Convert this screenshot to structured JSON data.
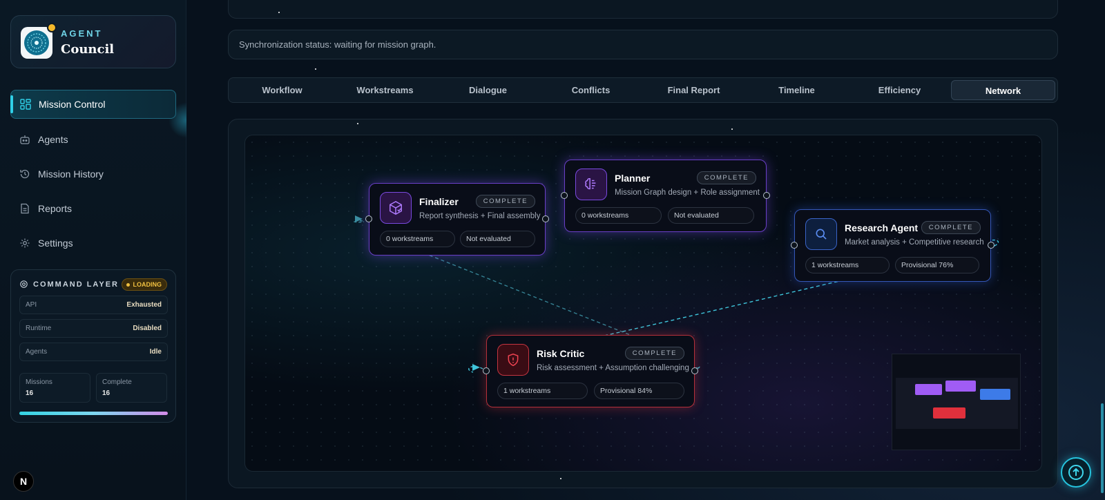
{
  "brand": {
    "subtitle": "AGENT",
    "title": "Council"
  },
  "nav": [
    {
      "label": "Mission Control",
      "icon": "grid-icon",
      "active": true
    },
    {
      "label": "Agents",
      "icon": "robot-icon"
    },
    {
      "label": "Mission History",
      "icon": "history-icon"
    },
    {
      "label": "Reports",
      "icon": "document-icon"
    },
    {
      "label": "Settings",
      "icon": "gear-icon"
    }
  ],
  "command_layer": {
    "title": "COMMAND LAYER",
    "badge": "LOADING",
    "rows": [
      {
        "key": "API",
        "value": "Exhausted"
      },
      {
        "key": "Runtime",
        "value": "Disabled"
      },
      {
        "key": "Agents",
        "value": "Idle"
      }
    ],
    "stats": [
      {
        "key": "Missions",
        "value": "16"
      },
      {
        "key": "Complete",
        "value": "16"
      }
    ]
  },
  "footer_badge": "N",
  "sync_status": "Synchronization status: waiting for mission graph.",
  "tabs": [
    {
      "label": "Workflow"
    },
    {
      "label": "Workstreams"
    },
    {
      "label": "Dialogue"
    },
    {
      "label": "Conflicts"
    },
    {
      "label": "Final Report"
    },
    {
      "label": "Timeline"
    },
    {
      "label": "Efficiency"
    },
    {
      "label": "Network",
      "active": true
    }
  ],
  "nodes": [
    {
      "name": "Finalizer",
      "status": "COMPLETE",
      "description": "Report synthesis + Final assembly",
      "workstreams": "0 workstreams",
      "evaluation": "Not evaluated",
      "icon": "package-check-icon",
      "color": "#8a4cf0"
    },
    {
      "name": "Planner",
      "status": "COMPLETE",
      "description": "Mission Graph design + Role assignment",
      "workstreams": "0 workstreams",
      "evaluation": "Not evaluated",
      "icon": "brain-icon",
      "color": "#8a4cf0"
    },
    {
      "name": "Research Agent",
      "status": "COMPLETE",
      "description": "Market analysis + Competitive research",
      "workstreams": "1 workstreams",
      "evaluation": "Provisional 76%",
      "icon": "search-icon",
      "color": "#3d7be8"
    },
    {
      "name": "Risk Critic",
      "status": "COMPLETE",
      "description": "Risk assessment + Assumption challenging",
      "workstreams": "1 workstreams",
      "evaluation": "Provisional 84%",
      "icon": "shield-alert-icon",
      "color": "#e0303c"
    }
  ],
  "colors": {
    "accent": "#2fd0e8",
    "purple": "#8a4cf0",
    "blue": "#3d7be8",
    "red": "#e0303c",
    "warning": "#f0c040"
  }
}
